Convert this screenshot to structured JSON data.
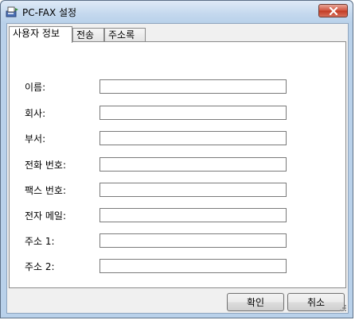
{
  "window": {
    "title": "PC-FAX 설정"
  },
  "tabs": [
    {
      "label": "사용자 정보",
      "active": true
    },
    {
      "label": "전송",
      "active": false
    },
    {
      "label": "주소록",
      "active": false
    }
  ],
  "fields": {
    "name": {
      "label": "이름:",
      "value": ""
    },
    "company": {
      "label": "회사:",
      "value": ""
    },
    "department": {
      "label": "부서:",
      "value": ""
    },
    "phone": {
      "label": "전화 번호:",
      "value": ""
    },
    "fax": {
      "label": "팩스 번호:",
      "value": ""
    },
    "email": {
      "label": "전자 메일:",
      "value": ""
    },
    "address1": {
      "label": "주소 1:",
      "value": ""
    },
    "address2": {
      "label": "주소 2:",
      "value": ""
    }
  },
  "buttons": {
    "ok": "확인",
    "cancel": "취소"
  },
  "icons": {
    "app": "fax-icon",
    "close": "close-icon",
    "grip": "resize-grip-icon"
  },
  "colors": {
    "close_button": "#c13a23",
    "frame": "#b9d1ea"
  }
}
